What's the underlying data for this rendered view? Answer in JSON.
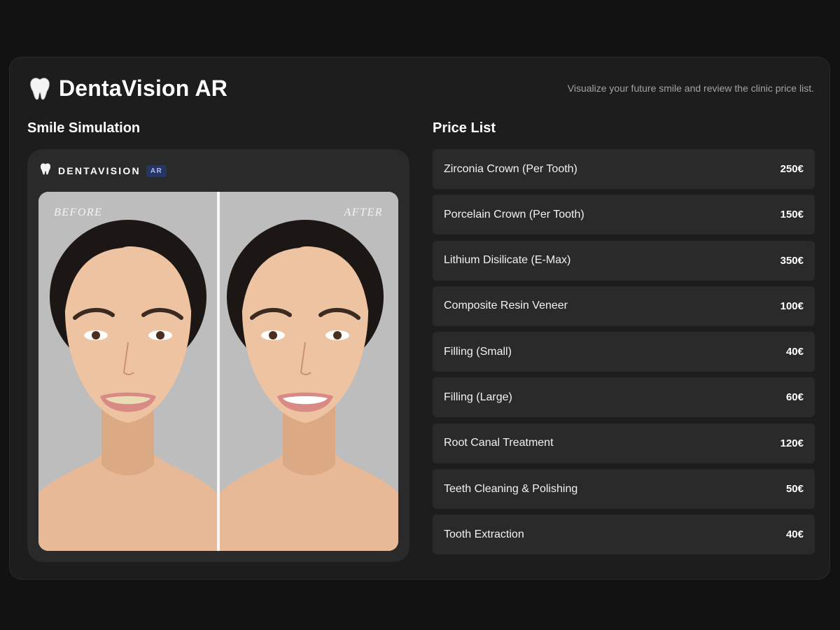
{
  "header": {
    "app_title": "DentaVision AR",
    "tagline": "Visualize your future smile and review the clinic price list.",
    "logo_icon": "tooth-icon"
  },
  "simulation": {
    "section_title": "Smile Simulation",
    "brand_name": "DENTAVISION",
    "brand_badge": "AR",
    "before_label": "BEFORE",
    "after_label": "AFTER",
    "photo_subject": "woman-portrait-smiling"
  },
  "prices": {
    "section_title": "Price List",
    "items": [
      {
        "name": "Zirconia Crown (Per Tooth)",
        "price": "250€"
      },
      {
        "name": "Porcelain Crown (Per Tooth)",
        "price": "150€"
      },
      {
        "name": "Lithium Disilicate (E-Max)",
        "price": "350€"
      },
      {
        "name": "Composite Resin Veneer",
        "price": "100€"
      },
      {
        "name": "Filling (Small)",
        "price": "40€"
      },
      {
        "name": "Filling (Large)",
        "price": "60€"
      },
      {
        "name": "Root Canal Treatment",
        "price": "120€"
      },
      {
        "name": "Teeth Cleaning & Polishing",
        "price": "50€"
      },
      {
        "name": "Tooth Extraction",
        "price": "40€"
      }
    ]
  },
  "colors": {
    "background": "#121212",
    "panel": "#1d1d1d",
    "card": "#2a2a2a",
    "badge": "#273660",
    "teeth_before": "#e9dcb4",
    "teeth_after": "#ffffff"
  }
}
